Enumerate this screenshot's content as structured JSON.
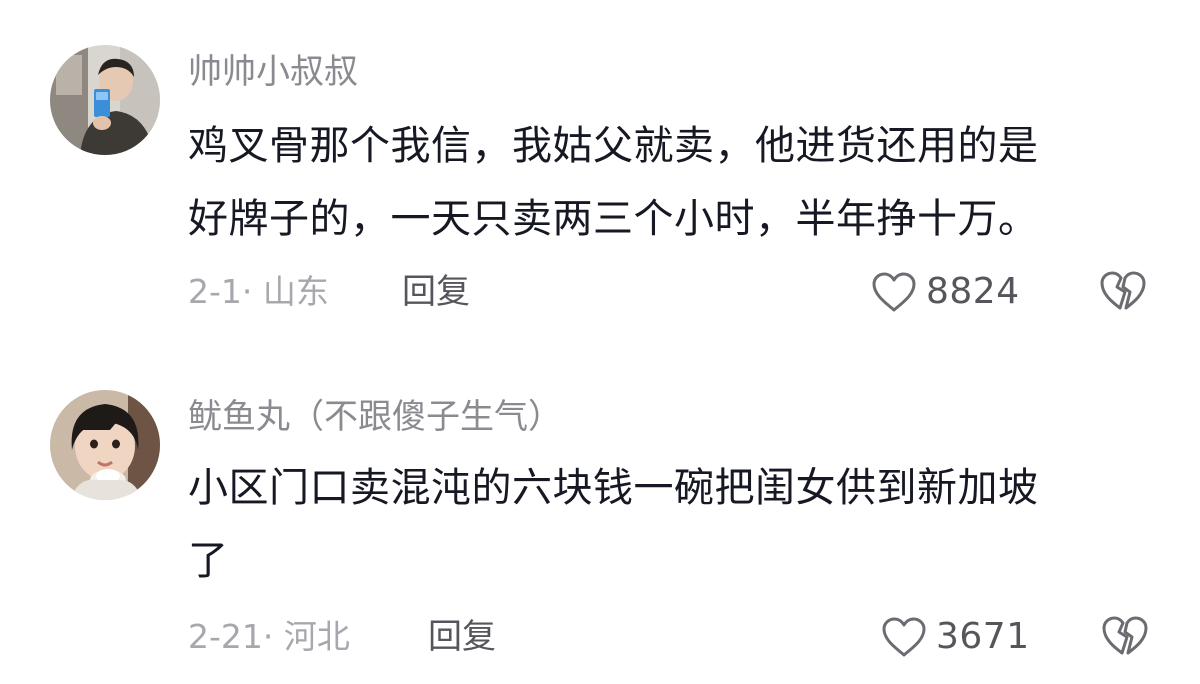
{
  "comments": [
    {
      "username": "帅帅小叔叔",
      "avatar_icon": "avatar-man-selfie",
      "text_lines": [
        "鸡叉骨那个我信，我姑父就卖，他进货还用的是",
        "好牌子的，一天只卖两三个小时，半年挣十万。"
      ],
      "date_location": "2-1· 山东",
      "reply_label": "回复",
      "like_icon": "heart-outline-icon",
      "like_count": "8824",
      "dislike_icon": "broken-heart-icon"
    },
    {
      "username": "鱿鱼丸（不跟傻子生气）",
      "avatar_icon": "avatar-girl-icecream",
      "text_lines": [
        "小区门口卖混沌的六块钱一碗把闺女供到新加坡",
        "了"
      ],
      "date_location": "2-21· 河北",
      "reply_label": "回复",
      "like_icon": "heart-outline-icon",
      "like_count": "3671",
      "dislike_icon": "broken-heart-icon"
    }
  ],
  "colors": {
    "username": "#8a8b91",
    "body_text": "#161823",
    "meta": "#a7a8ad",
    "reply": "#55565c",
    "icon_stroke": "#6b6c72"
  }
}
